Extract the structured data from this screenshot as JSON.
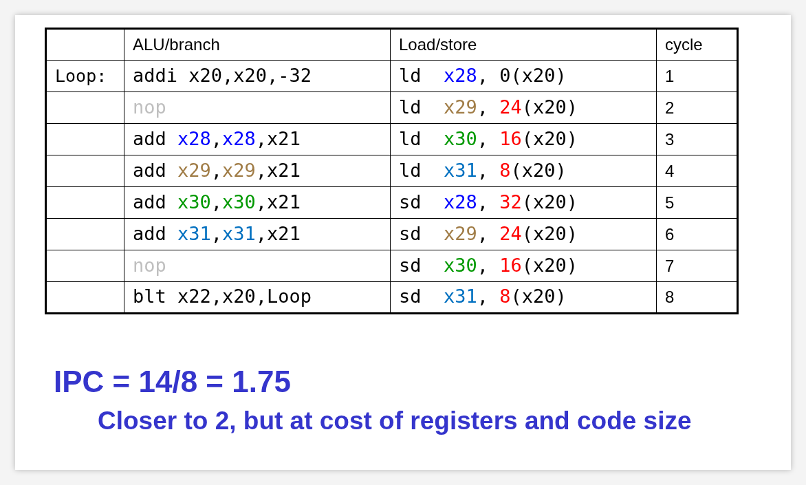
{
  "table": {
    "columns": [
      "ALU/branch",
      "Load/store",
      "cycle"
    ],
    "rows": [
      {
        "label": "Loop:",
        "alu": [
          {
            "text": "addi x20,x20,-32",
            "color": "#000000"
          }
        ],
        "ls": [
          {
            "text": "ld  ",
            "color": "#000000"
          },
          {
            "text": "x28",
            "color": "#0000ff"
          },
          {
            "text": ", 0(x20)",
            "color": "#000000"
          }
        ],
        "cycle": "1"
      },
      {
        "alu": [
          {
            "text": "nop",
            "color": "#bfbfbf"
          }
        ],
        "ls": [
          {
            "text": "ld  ",
            "color": "#000000"
          },
          {
            "text": "x29",
            "color": "#a07c46"
          },
          {
            "text": ", ",
            "color": "#000000"
          },
          {
            "text": "24",
            "color": "#ff0000"
          },
          {
            "text": "(x20)",
            "color": "#000000"
          }
        ],
        "cycle": "2"
      },
      {
        "alu": [
          {
            "text": "add ",
            "color": "#000000"
          },
          {
            "text": "x28",
            "color": "#0000ff"
          },
          {
            "text": ",",
            "color": "#000000"
          },
          {
            "text": "x28",
            "color": "#0000ff"
          },
          {
            "text": ",x21",
            "color": "#000000"
          }
        ],
        "ls": [
          {
            "text": "ld  ",
            "color": "#000000"
          },
          {
            "text": "x30",
            "color": "#009900"
          },
          {
            "text": ", ",
            "color": "#000000"
          },
          {
            "text": "16",
            "color": "#ff0000"
          },
          {
            "text": "(x20)",
            "color": "#000000"
          }
        ],
        "cycle": "3"
      },
      {
        "alu": [
          {
            "text": "add ",
            "color": "#000000"
          },
          {
            "text": "x29",
            "color": "#a07c46"
          },
          {
            "text": ",",
            "color": "#000000"
          },
          {
            "text": "x29",
            "color": "#a07c46"
          },
          {
            "text": ",x21",
            "color": "#000000"
          }
        ],
        "ls": [
          {
            "text": "ld  ",
            "color": "#000000"
          },
          {
            "text": "x31",
            "color": "#0070c0"
          },
          {
            "text": ", ",
            "color": "#000000"
          },
          {
            "text": "8",
            "color": "#ff0000"
          },
          {
            "text": "(x20)",
            "color": "#000000"
          }
        ],
        "cycle": "4"
      },
      {
        "alu": [
          {
            "text": "add ",
            "color": "#000000"
          },
          {
            "text": "x30",
            "color": "#009900"
          },
          {
            "text": ",",
            "color": "#000000"
          },
          {
            "text": "x30",
            "color": "#009900"
          },
          {
            "text": ",x21",
            "color": "#000000"
          }
        ],
        "ls": [
          {
            "text": "sd  ",
            "color": "#000000"
          },
          {
            "text": "x28",
            "color": "#0000ff"
          },
          {
            "text": ", ",
            "color": "#000000"
          },
          {
            "text": "32",
            "color": "#ff0000"
          },
          {
            "text": "(x20)",
            "color": "#000000"
          }
        ],
        "cycle": "5"
      },
      {
        "alu": [
          {
            "text": "add ",
            "color": "#000000"
          },
          {
            "text": "x31",
            "color": "#0070c0"
          },
          {
            "text": ",",
            "color": "#000000"
          },
          {
            "text": "x31",
            "color": "#0070c0"
          },
          {
            "text": ",x21",
            "color": "#000000"
          }
        ],
        "ls": [
          {
            "text": "sd  ",
            "color": "#000000"
          },
          {
            "text": "x29",
            "color": "#a07c46"
          },
          {
            "text": ", ",
            "color": "#000000"
          },
          {
            "text": "24",
            "color": "#ff0000"
          },
          {
            "text": "(x20)",
            "color": "#000000"
          }
        ],
        "cycle": "6"
      },
      {
        "alu": [
          {
            "text": "nop",
            "color": "#bfbfbf"
          }
        ],
        "ls": [
          {
            "text": "sd  ",
            "color": "#000000"
          },
          {
            "text": "x30",
            "color": "#009900"
          },
          {
            "text": ", ",
            "color": "#000000"
          },
          {
            "text": "16",
            "color": "#ff0000"
          },
          {
            "text": "(x20)",
            "color": "#000000"
          }
        ],
        "cycle": "7"
      },
      {
        "alu": [
          {
            "text": "blt x22,x20,Loop",
            "color": "#000000"
          }
        ],
        "ls": [
          {
            "text": "sd  ",
            "color": "#000000"
          },
          {
            "text": "x31",
            "color": "#0070c0"
          },
          {
            "text": ", ",
            "color": "#000000"
          },
          {
            "text": "8",
            "color": "#ff0000"
          },
          {
            "text": "(x20)",
            "color": "#000000"
          }
        ],
        "cycle": "8"
      }
    ]
  },
  "ipc": "IPC = 14/8 = 1.75",
  "note": "Closer to 2, but at cost of registers and code size"
}
